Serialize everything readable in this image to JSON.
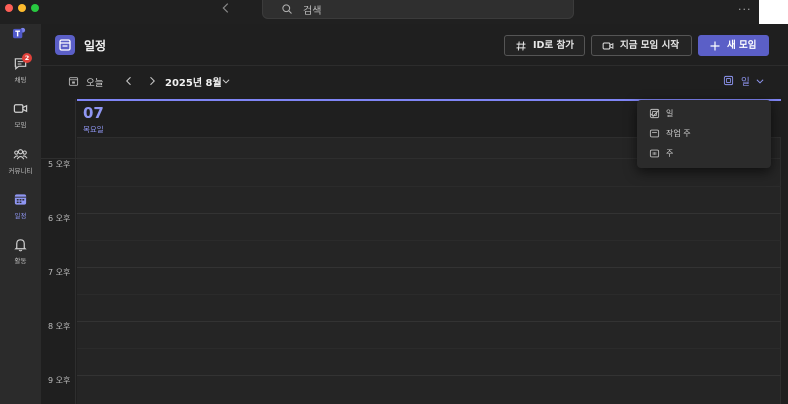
{
  "titlebar": {
    "search_placeholder": "검색",
    "more": "···"
  },
  "rail": {
    "items": [
      {
        "label": "채팅",
        "icon": "chat-icon",
        "badge": "2"
      },
      {
        "label": "모임",
        "icon": "video-icon"
      },
      {
        "label": "커뮤니티",
        "icon": "people-icon"
      },
      {
        "label": "일정",
        "icon": "calendar-icon",
        "active": true
      },
      {
        "label": "활동",
        "icon": "bell-icon"
      }
    ]
  },
  "header": {
    "title": "일정",
    "join_by_id": "ID로 참가",
    "meet_now": "지금 모임 시작",
    "new_meeting": "새 모임"
  },
  "nav": {
    "today": "오늘",
    "month": "2025년 8월",
    "view": "일"
  },
  "day": {
    "number": "07",
    "weekday": "목요일"
  },
  "hours": [
    "5 오후",
    "6 오후",
    "7 오후",
    "8 오후",
    "9 오후"
  ],
  "view_menu": {
    "items": [
      {
        "label": "일",
        "icon": "day-view-icon",
        "checked": true
      },
      {
        "label": "작업 주",
        "icon": "work-week-icon"
      },
      {
        "label": "주",
        "icon": "week-view-icon"
      }
    ]
  },
  "colors": {
    "accent": "#5b5fc7",
    "accent_light": "#8f96f2",
    "badge": "#e0413a"
  }
}
